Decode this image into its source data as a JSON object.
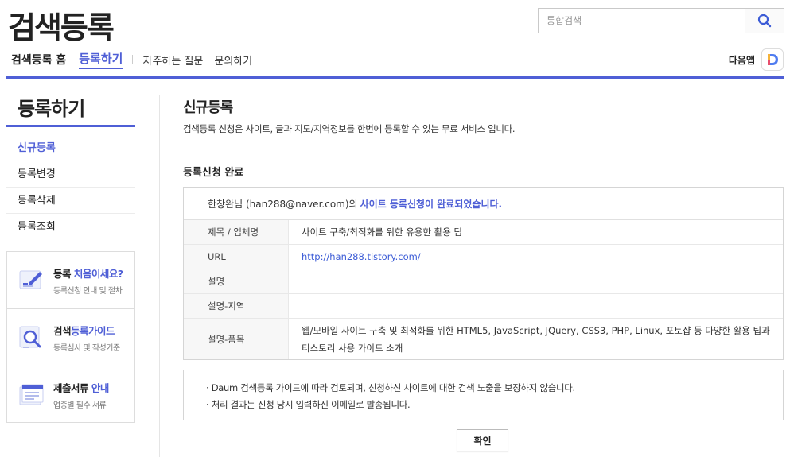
{
  "header": {
    "logo": "검색등록",
    "search_placeholder": "통합검색",
    "daum_app_label": "다음앱"
  },
  "gnb": {
    "home": "검색등록 홈",
    "register": "등록하기",
    "faq": "자주하는 질문",
    "inquiry": "문의하기"
  },
  "sidebar": {
    "title": "등록하기",
    "items": [
      {
        "label": "신규등록",
        "active": true
      },
      {
        "label": "등록변경",
        "active": false
      },
      {
        "label": "등록삭제",
        "active": false
      },
      {
        "label": "등록조회",
        "active": false
      }
    ],
    "promos": [
      {
        "title_a": "등록 ",
        "title_b": "처음이세요?",
        "sub": "등록신청 안내 및 절차",
        "icon": "pencil-doc-icon"
      },
      {
        "title_a": "검색",
        "title_b": "등록가이드",
        "sub": "등록심사 및 작성기준",
        "icon": "magnifier-doc-icon"
      },
      {
        "title_a": "제출서류 ",
        "title_b": "안내",
        "sub": "업종별 필수 서류",
        "icon": "document-stack-icon"
      }
    ]
  },
  "content": {
    "title": "신규등록",
    "description": "검색등록 신청은 사이트, 글과 지도/지역정보를 한번에 등록할 수 있는 무료 서비스 입니다.",
    "section_title": "등록신청 완료",
    "result_prefix": "한창완님 (han288@naver.com)의",
    "result_strong": "사이트 등록신청이 완료되었습니다.",
    "rows": [
      {
        "label": "제목 / 업체명",
        "value": "사이트 구축/최적화를 위한 유용한 활용 팁"
      },
      {
        "label": "URL",
        "value": "http://han288.tistory.com/"
      },
      {
        "label": "설명",
        "value": ""
      },
      {
        "label": "설명-지역",
        "value": ""
      },
      {
        "label": "설명-품목",
        "value": "웹/모바일 사이트 구축 및 최적화를 위한 HTML5, JavaScript, JQuery, CSS3, PHP, Linux, 포토샵 등 다양한 활용 팁과 티스토리 사용 가이드 소개"
      }
    ],
    "notices": [
      "· Daum 검색등록 가이드에 따라 검토되며, 신청하신 사이트에 대한 검색 노출을 보장하지 않습니다.",
      "· 처리 결과는 신청 당시 입력하신 이메일로 발송됩니다."
    ],
    "confirm_label": "확인"
  },
  "colors": {
    "accent": "#4f5fd6",
    "link": "#3b5bd6"
  }
}
